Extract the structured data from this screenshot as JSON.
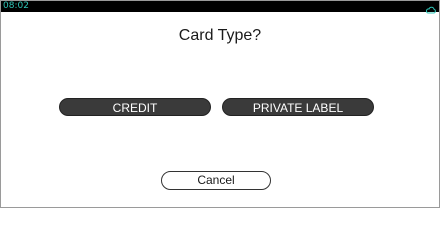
{
  "status_bar": {
    "time": "08:02",
    "time_color": "#2ec4b6",
    "icon": "cloud-icon"
  },
  "dialog": {
    "title": "Card Type?"
  },
  "buttons": {
    "credit_label": "CREDIT",
    "private_label_label": "PRIVATE LABEL",
    "cancel_label": "Cancel"
  }
}
